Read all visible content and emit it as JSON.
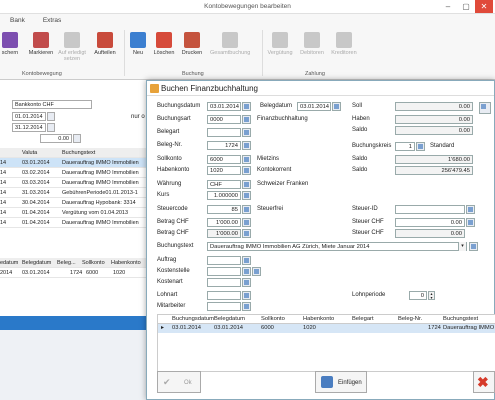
{
  "background_window": {
    "title": "Kontobewegungen bearbeiten",
    "tabs": [
      "Bank",
      "Extras"
    ],
    "ribbon_buttons": [
      {
        "label": "schern",
        "disabled": false,
        "color": "#7d4fb0"
      },
      {
        "label": "Markieren",
        "disabled": false,
        "color": "#c14c4c"
      },
      {
        "label": "Auf erledigt setzen",
        "disabled": true,
        "color": "#b5b5b5"
      },
      {
        "label": "Aufteilen",
        "disabled": false,
        "color": "#c94b3c"
      },
      {
        "label": "Neu",
        "disabled": false,
        "color": "#3c7fd0"
      },
      {
        "label": "Löschen",
        "disabled": false,
        "color": "#d64a3a"
      },
      {
        "label": "Drucken",
        "disabled": false,
        "color": "#c5543e"
      },
      {
        "label": "Gesamtbuchung",
        "disabled": true,
        "color": "#b5b5b5"
      },
      {
        "label": "Vergütung",
        "disabled": true,
        "color": "#b5b5b5"
      },
      {
        "label": "Debitoren",
        "disabled": true,
        "color": "#b5b5b5"
      },
      {
        "label": "Kreditoren",
        "disabled": true,
        "color": "#b5b5b5"
      }
    ],
    "groups": [
      "Kontobewegung",
      "Buchung",
      "Zahlung"
    ],
    "form": {
      "konto": "Bankkonto CHF",
      "date_from": "01.01.2014",
      "date_to": "31.12.2014",
      "amount": "0.00",
      "partial_label": "nur o"
    },
    "table": {
      "headers": [
        "Valuta",
        "Buchungstext"
      ],
      "rows": [
        {
          "col0": "14",
          "valuta": "03.01.2014",
          "text": "Dauerauftrag IMMO Immobilien",
          "selected": true
        },
        {
          "col0": "14",
          "valuta": "03.02.2014",
          "text": "Dauerauftrag IMMO Immobilien",
          "selected": false
        },
        {
          "col0": "14",
          "valuta": "03.03.2014",
          "text": "Dauerauftrag IMMO Immobilien",
          "selected": false
        },
        {
          "col0": "14",
          "valuta": "31.03.2014",
          "text": "GebührenPeriode01.01.2013-1",
          "selected": false
        },
        {
          "col0": "14",
          "valuta": "30.04.2014",
          "text": "Dauerauftrag Hypobank: 3314",
          "selected": false
        },
        {
          "col0": "14",
          "valuta": "01.04.2014",
          "text": "Vergütung vom 01.04.2013",
          "selected": false
        },
        {
          "col0": "14",
          "valuta": "01.04.2014",
          "text": "Dauerauftrag IMMO Immobilien",
          "selected": false
        }
      ]
    },
    "bottom_table": {
      "headers": [
        "edatum",
        "Belegdatum",
        "Beleg...",
        "Sollkonto",
        "Habenkonto",
        "B"
      ],
      "row": [
        "2014",
        "03.01.2014",
        "1724",
        "6000",
        "1020",
        ""
      ]
    }
  },
  "dialog": {
    "title": "Buchen Finanzbuchhaltung",
    "fields": {
      "buchungsdatum_label": "Buchungsdatum",
      "buchungsdatum": "03.01.2014",
      "belegdatum_label": "Belegdatum",
      "belegdatum": "03.01.2014",
      "buchungsart_label": "Buchungsart",
      "buchungsart": "0000",
      "buchungsart_desc": "Finanzbuchhaltung",
      "belegart_label": "Belegart",
      "belegart": "",
      "belegnr_label": "Beleg-Nr.",
      "belegnr": "1724",
      "sollkonto_label": "Sollkonto",
      "sollkonto": "6000",
      "sollkonto_desc": "Mietzins",
      "habenkonto_label": "Habenkonto",
      "habenkonto": "1020",
      "habenkonto_desc": "Kontokorrent",
      "waehrung_label": "Währung",
      "waehrung": "CHF",
      "waehrung_desc": "Schweizer Franken",
      "kurs_label": "Kurs",
      "kurs": "1.000000",
      "steuercode_label": "Steuercode",
      "steuercode": "85",
      "steuercode_desc": "Steuerfrei",
      "betrag_label": "Betrag CHF",
      "betrag": "1'000.00",
      "betrag2_label": "Betrag CHF",
      "betrag2": "1'000.00",
      "buchungstext_label": "Buchungstext",
      "buchungstext": "Dauerauftrag IMMO Immobilien AG Zürich, Miete Januar 2014",
      "auftrag_label": "Auftrag",
      "kostenstelle_label": "Kostenstelle",
      "kostenart_label": "Kostenart",
      "lohnart_label": "Lohnart",
      "mitarbeiter_label": "Mitarbeiter",
      "lohnperiode_label": "Lohnperiode",
      "lohnperiode": "0"
    },
    "right": {
      "soll_label": "Soll",
      "soll": "0.00",
      "haben_label": "Haben",
      "haben": "0.00",
      "saldo_label": "Saldo",
      "saldo": "0.00",
      "buchungskreis_label": "Buchungskreis",
      "buchungskreis": "1",
      "buchungskreis_desc": "Standard",
      "soll2_label": "Saldo",
      "soll2": "1'680.00",
      "haben2_label": "Saldo",
      "haben2": "256'479.45",
      "steuerid_label": "Steuer-ID",
      "steuerid": "",
      "steuerchf_label": "Steuer CHF",
      "steuerchf": "0.00",
      "steuerchf2_label": "Steuer CHF",
      "steuerchf2": "0.00"
    },
    "grid": {
      "headers": [
        "Buchungsdatum",
        "Belegdatum",
        "Sollkonto",
        "Habenkonto",
        "Belegart",
        "Beleg-Nr.",
        "Buchungstext"
      ],
      "row": [
        "03.01.2014",
        "03.01.2014",
        "6000",
        "1020",
        "",
        "1724",
        "Dauerauftrag IMMO Immo"
      ]
    },
    "buttons": {
      "ok": "Ok",
      "einfuegen": "Einfügen"
    }
  }
}
